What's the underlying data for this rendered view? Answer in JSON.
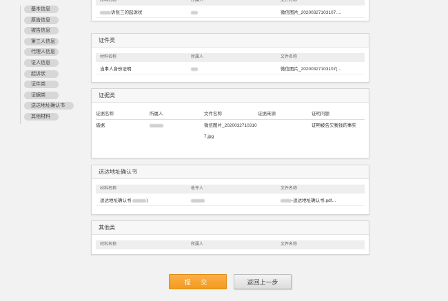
{
  "sidebar": {
    "items": [
      {
        "label": "基本信息"
      },
      {
        "label": "原告信息"
      },
      {
        "label": "被告信息"
      },
      {
        "label": "第三人信息"
      },
      {
        "label": "代理人信息"
      },
      {
        "label": "证人信息"
      },
      {
        "label": "起诉状"
      },
      {
        "label": "证件类"
      },
      {
        "label": "证据类"
      },
      {
        "label": "送达地址确认书"
      },
      {
        "label": "其他材料"
      }
    ]
  },
  "complaint_panel": {
    "columns": [
      "材料名称",
      "所属人",
      "文件名称"
    ],
    "row": {
      "material": "诉张三的起诉状",
      "file": "微信图片_20200327103107.…"
    }
  },
  "id_panel": {
    "title": "证件类",
    "columns": [
      "材料名称",
      "所属人",
      "文件名称"
    ],
    "row": {
      "material": "当事人身份证明",
      "file": "微信图片_20200327103107(…"
    }
  },
  "evidence_panel": {
    "title": "证据类",
    "columns": [
      "证据名称",
      "所属人",
      "文件名称",
      "证据来源",
      "证明问题"
    ],
    "row": {
      "name": "借据",
      "file_line1": "微信图片_2020032710310",
      "file_line2": "7.jpg",
      "purpose": "证明被告欠我钱的事实"
    }
  },
  "address_panel": {
    "title": "送达地址确认书",
    "columns": [
      "材料名称",
      "收件人",
      "文件名称"
    ],
    "row": {
      "material": "送达地址确认书",
      "material_suffix": ")",
      "file": "-送达地址确认书.pdf…"
    }
  },
  "other_panel": {
    "title": "其他类",
    "columns": [
      "材料名称",
      "所属人",
      "文件名称"
    ]
  },
  "buttons": {
    "submit": "提 交",
    "back": "返回上一步"
  }
}
